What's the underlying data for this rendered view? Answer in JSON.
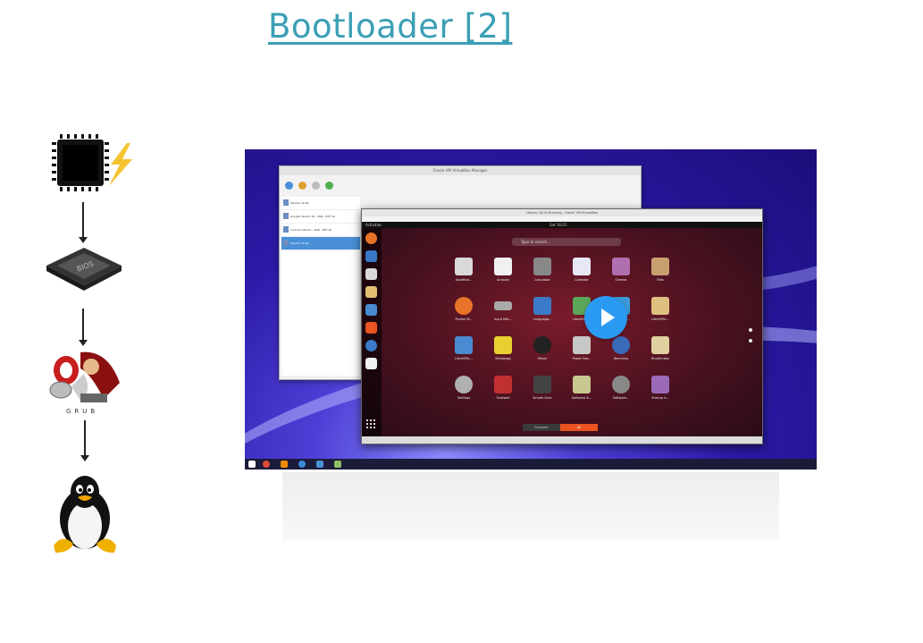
{
  "slide": {
    "title": "Bootloader [2]"
  },
  "flow": {
    "steps": [
      {
        "name": "cpu-chip",
        "icon": "cpu-chip-icon"
      },
      {
        "name": "bios",
        "icon": "bios-chip-icon",
        "label": "BIOS"
      },
      {
        "name": "grub",
        "icon": "grub-mascot-icon",
        "label": "GRUB"
      },
      {
        "name": "linux",
        "icon": "tux-penguin-icon"
      }
    ]
  },
  "screenshot": {
    "vbox_title": "Oracle VM VirtualBox Manager",
    "vms": [
      "Ubuntu 16.04",
      "Google Ubuntu 18 - 4GB - RPT 19",
      "Cudnux Ubuntu - 4GB - RPT 16",
      "Ubuntu 18.04"
    ],
    "ubuntu_title": "Ubuntu 18.04 Running - Oracle VM VirtualBox",
    "activities": "Activities",
    "clock": "Sat 16:01",
    "search_placeholder": "Type to search...",
    "apps": [
      {
        "label": "AisleRiot...",
        "color": "#d9d9d9"
      },
      {
        "label": "Amazon",
        "color": "#f0f0f0"
      },
      {
        "label": "Calculator",
        "color": "#888888"
      },
      {
        "label": "Calendar",
        "color": "#e8e8f4"
      },
      {
        "label": "Cheese",
        "color": "#b070b0"
      },
      {
        "label": "Files",
        "color": "#c8a070"
      },
      {
        "label": "Firefox W...",
        "color": "#e8742a"
      },
      {
        "label": "Input Met...",
        "color": "#aaaaaa"
      },
      {
        "label": "Language...",
        "color": "#3a7ac8"
      },
      {
        "label": "LibreOffic...",
        "color": "#5aa65a"
      },
      {
        "label": "LibreOffic...",
        "color": "#3a9ad8"
      },
      {
        "label": "LibreOffic...",
        "color": "#e0c080"
      },
      {
        "label": "LibreOffic...",
        "color": "#4a8ad0"
      },
      {
        "label": "Mahjongg",
        "color": "#e8d030"
      },
      {
        "label": "Mines",
        "color": "#222222"
      },
      {
        "label": "Power Sta...",
        "color": "#c8c8c8"
      },
      {
        "label": "Remmina",
        "color": "#3a6ab8"
      },
      {
        "label": "Rhythmbox",
        "color": "#e0d0a0"
      },
      {
        "label": "Settings",
        "color": "#b0b0b0"
      },
      {
        "label": "Shotwell",
        "color": "#c03030"
      },
      {
        "label": "Simple Scan",
        "color": "#444444"
      },
      {
        "label": "Software &...",
        "color": "#c8c890"
      },
      {
        "label": "Software...",
        "color": "#888888"
      },
      {
        "label": "Startup A...",
        "color": "#9a6ab8"
      }
    ],
    "tab_frequent": "Frequent",
    "tab_all": "All"
  }
}
